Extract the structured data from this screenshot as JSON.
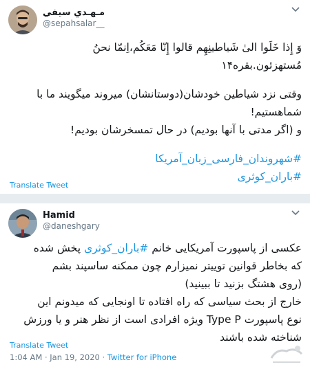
{
  "tweet1": {
    "display_name": "مـهـدي سيفي",
    "handle": "@sepahsalar__",
    "lines": [
      "وَ إِذا خَلَوا الیٰ شَیاطینِهِم قالوا إِنّا مَعَکُم،اِنمّا نحنُ",
      "مُستهزئون.بقره۱۴"
    ],
    "lines2": [
      "وقتی نزد شیاطین خودشان(دوستانشان) میروند میگویند ما با",
      "شماهستیم!",
      "و (اگر مدتی با آنها بودیم) در حال تمسخرشان بودیم!"
    ],
    "hashtags": [
      "#شهروندان_فارسی_زبان_آمریکا",
      "#باران_کوثری"
    ],
    "translate_label": "Translate Tweet"
  },
  "tweet2": {
    "display_name": "Hamid",
    "handle": "@daneshgary",
    "line1_prefix": "عکسی از پاسپورت آمریکایی خانم",
    "line1_hashtag": "#باران_کوثری",
    "line1_suffix": "پخش شده",
    "lines": [
      "که بخاطر قوانین توییتر نمیزارم چون ممکنه ساسپند بشم",
      "(روی هشتگ بزنید تا ببینید)",
      "خارج از بحث سیاسی که راه افتاده تا اونجایی که میدونم این",
      "نوع پاسپورت Type P ویژه افرادی است از نظر هنر و یا ورزش",
      "شناخته شده باشند"
    ],
    "translate_label": "Translate Tweet",
    "time": "1:04 AM",
    "separator": "·",
    "date": "Jan 19, 2020",
    "source": "Twitter for iPhone"
  },
  "colors": {
    "link": "#1b95e0",
    "muted": "#657786",
    "text": "#14171a",
    "gap": "#e6ecf0"
  },
  "icons": [
    "chevron-down-icon",
    "avatar",
    "watermark-logo"
  ]
}
